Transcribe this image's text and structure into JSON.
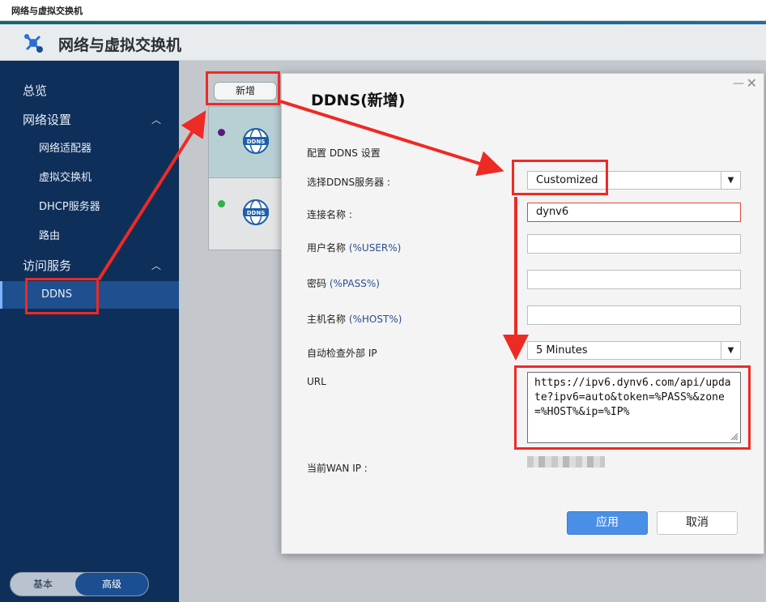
{
  "window": {
    "title": "网络与虚拟交换机"
  },
  "app": {
    "title": "网络与虚拟交换机",
    "logo_icon": "network-switch-icon"
  },
  "sidebar": {
    "items": [
      {
        "label": "总览"
      },
      {
        "label": "网络设置",
        "caret": "︿"
      },
      {
        "label": "网络适配器"
      },
      {
        "label": "虚拟交换机"
      },
      {
        "label": "DHCP服务器"
      },
      {
        "label": "路由"
      },
      {
        "label": "访问服务",
        "caret": "︿"
      },
      {
        "label": "DDNS"
      }
    ],
    "active": "DDNS",
    "mode": {
      "basic": "基本",
      "advanced": "高级",
      "selected": "高级"
    }
  },
  "list": {
    "add_label": "新增",
    "cards": [
      {
        "status_color": "#5a1a78",
        "badge": "DDNS"
      },
      {
        "status_color": "#2db34a",
        "badge": "DDNS"
      }
    ]
  },
  "dialog": {
    "title": "DDNS(新增)",
    "minimize": "—",
    "close": "✕",
    "section": "配置 DDNS 设置",
    "service_label": "选择DDNS服务器 :",
    "service_value": "Customized",
    "name_label": "连接名称 :",
    "name_value": "dynv6",
    "user_label": "用户名称 ",
    "user_var": "(%USER%)",
    "user_value": "",
    "pass_label": "密码 ",
    "pass_var": "(%PASS%)",
    "pass_value": "",
    "host_label": "主机名称 ",
    "host_var": "(%HOST%)",
    "host_value": "",
    "check_label": "自动检查外部 IP",
    "check_value": "5 Minutes",
    "url_label": "URL",
    "url_value": "https://ipv6.dynv6.com/api/update?ipv6=auto&token=%PASS%&zone=%HOST%&ip=%IP%",
    "wan_label": "当前WAN IP :",
    "apply": "应用",
    "cancel": "取消",
    "dropdown_arrow": "▼"
  },
  "colors": {
    "sidebar_bg": "#0e2f5a",
    "active_bg": "#1f4f8f",
    "apply_blue": "#4a8fe7",
    "annotation_red": "#ee2a24"
  }
}
